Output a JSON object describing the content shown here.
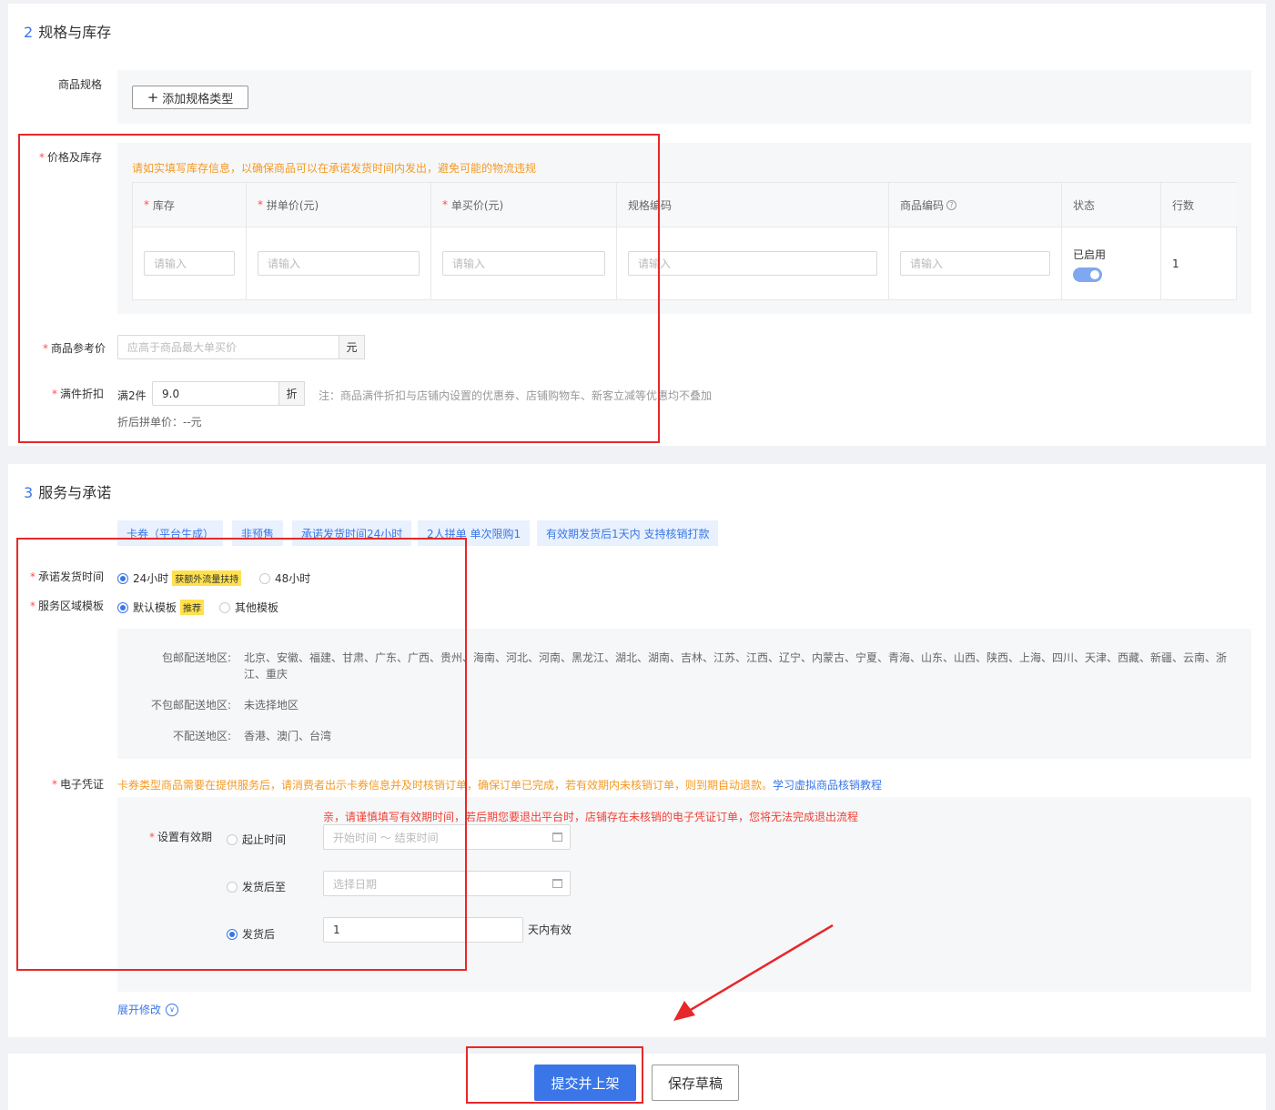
{
  "section2": {
    "num": "2",
    "title": "规格与库存",
    "spec_label": "商品规格",
    "add_spec_button": "添加规格类型",
    "price_stock_label": "价格及库存",
    "warning": "请如实填写库存信息，以确保商品可以在承诺发货时间内发出，避免可能的物流违规",
    "table": {
      "headers": [
        "库存",
        "拼单价(元)",
        "单买价(元)",
        "规格编码",
        "商品编码",
        "状态",
        "行数"
      ],
      "placeholder": "请输入",
      "status_text": "已启用",
      "row_count": "1"
    },
    "ref_price_label": "商品参考价",
    "ref_price_placeholder": "应高于商品最大单买价",
    "ref_price_unit": "元",
    "discount_label": "满件折扣",
    "discount_prefix": "满2件",
    "discount_value": "9.0",
    "discount_unit": "折",
    "discount_note": "注：商品满件折扣与店铺内设置的优惠券、店铺购物车、新客立减等优惠均不叠加",
    "discount_price": "折后拼单价：--元"
  },
  "section3": {
    "num": "3",
    "title": "服务与承诺",
    "tags": [
      "卡券（平台生成）",
      "非预售",
      "承诺发货时间24小时",
      "2人拼单 单次限购1",
      "有效期发货后1天内 支持核销打款"
    ],
    "ship_time_label": "承诺发货时间",
    "ship_opt1": "24小时",
    "ship_badge": "获额外流量扶持",
    "ship_opt2": "48小时",
    "region_label": "服务区域模板",
    "region_opt1": "默认模板",
    "region_badge": "推荐",
    "region_opt2": "其他模板",
    "free_label": "包邮配送地区:",
    "free_regions_line1": "北京、安徽、福建、甘肃、广东、广西、贵州、海南、河北、河南、黑龙江、湖北、湖南、吉林、江苏、江西、辽宁、内蒙古、宁夏、青海、山东、山西、陕西、上海、四川、天津、西藏、新疆、云南、浙",
    "free_regions_line2": "江、重庆",
    "nonfree_label": "不包邮配送地区:",
    "nonfree_value": "未选择地区",
    "nodeliver_label": "不配送地区:",
    "nodeliver_value": "香港、澳门、台湾",
    "voucher_label": "电子凭证",
    "voucher_note": "卡券类型商品需要在提供服务后，请消费者出示卡券信息并及时核销订单，确保订单已完成，若有效期内未核销订单，则到期自动退款。",
    "voucher_link": "学习虚拟商品核销教程",
    "validity_warning": "亲，请谨慎填写有效期时间，若后期您要退出平台时，店铺存在未核销的电子凭证订单，您将无法完成退出流程",
    "validity_label": "设置有效期",
    "opt_range": "起止时间",
    "range_placeholder": "开始时间 ～ 结束时间",
    "opt_after_until": "发货后至",
    "date_placeholder": "选择日期",
    "opt_after": "发货后",
    "after_days": "1",
    "after_unit": "天内有效",
    "expand": "展开修改"
  },
  "footer": {
    "submit": "提交并上架",
    "draft": "保存草稿"
  },
  "colors": {
    "accent": "#3a76e8",
    "warning": "#f59a23",
    "error": "#f04134",
    "annotation": "#e8272a"
  }
}
